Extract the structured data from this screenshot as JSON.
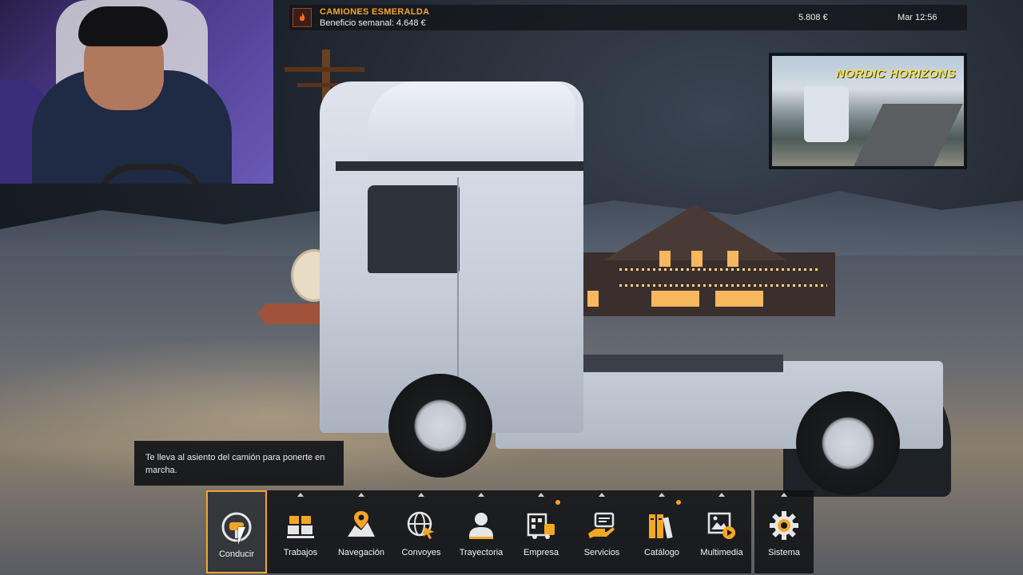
{
  "topbar": {
    "company_name": "CAMIONES ESMERALDA",
    "weekly_profit": "Beneficio semanal: 4.648 €",
    "money": "5.808 €",
    "clock": "Mar 12:56"
  },
  "promo": {
    "title": "NORDIC HORIZONS"
  },
  "tooltip": {
    "text": "Te lleva al asiento del camión para ponerte en marcha."
  },
  "menu": {
    "items": [
      {
        "label": "Conducir",
        "icon": "steering-wheel-icon",
        "active": true,
        "notify": false
      },
      {
        "label": "Trabajos",
        "icon": "cargo-boxes-icon",
        "active": false,
        "notify": false
      },
      {
        "label": "Navegación",
        "icon": "map-pin-icon",
        "active": false,
        "notify": false
      },
      {
        "label": "Convoyes",
        "icon": "globe-cursor-icon",
        "active": false,
        "notify": false
      },
      {
        "label": "Trayectoria",
        "icon": "profile-icon",
        "active": false,
        "notify": false
      },
      {
        "label": "Empresa",
        "icon": "company-truck-icon",
        "active": false,
        "notify": true
      },
      {
        "label": "Servicios",
        "icon": "service-hand-icon",
        "active": false,
        "notify": false
      },
      {
        "label": "Catálogo",
        "icon": "books-icon",
        "active": false,
        "notify": true
      },
      {
        "label": "Multimedia",
        "icon": "media-play-icon",
        "active": false,
        "notify": false
      },
      {
        "label": "Sistema",
        "icon": "gear-icon",
        "active": false,
        "notify": false
      }
    ]
  },
  "colors": {
    "accent": "#f5a623",
    "panel": "#101216",
    "brand_icon": "#ff7a2a"
  }
}
